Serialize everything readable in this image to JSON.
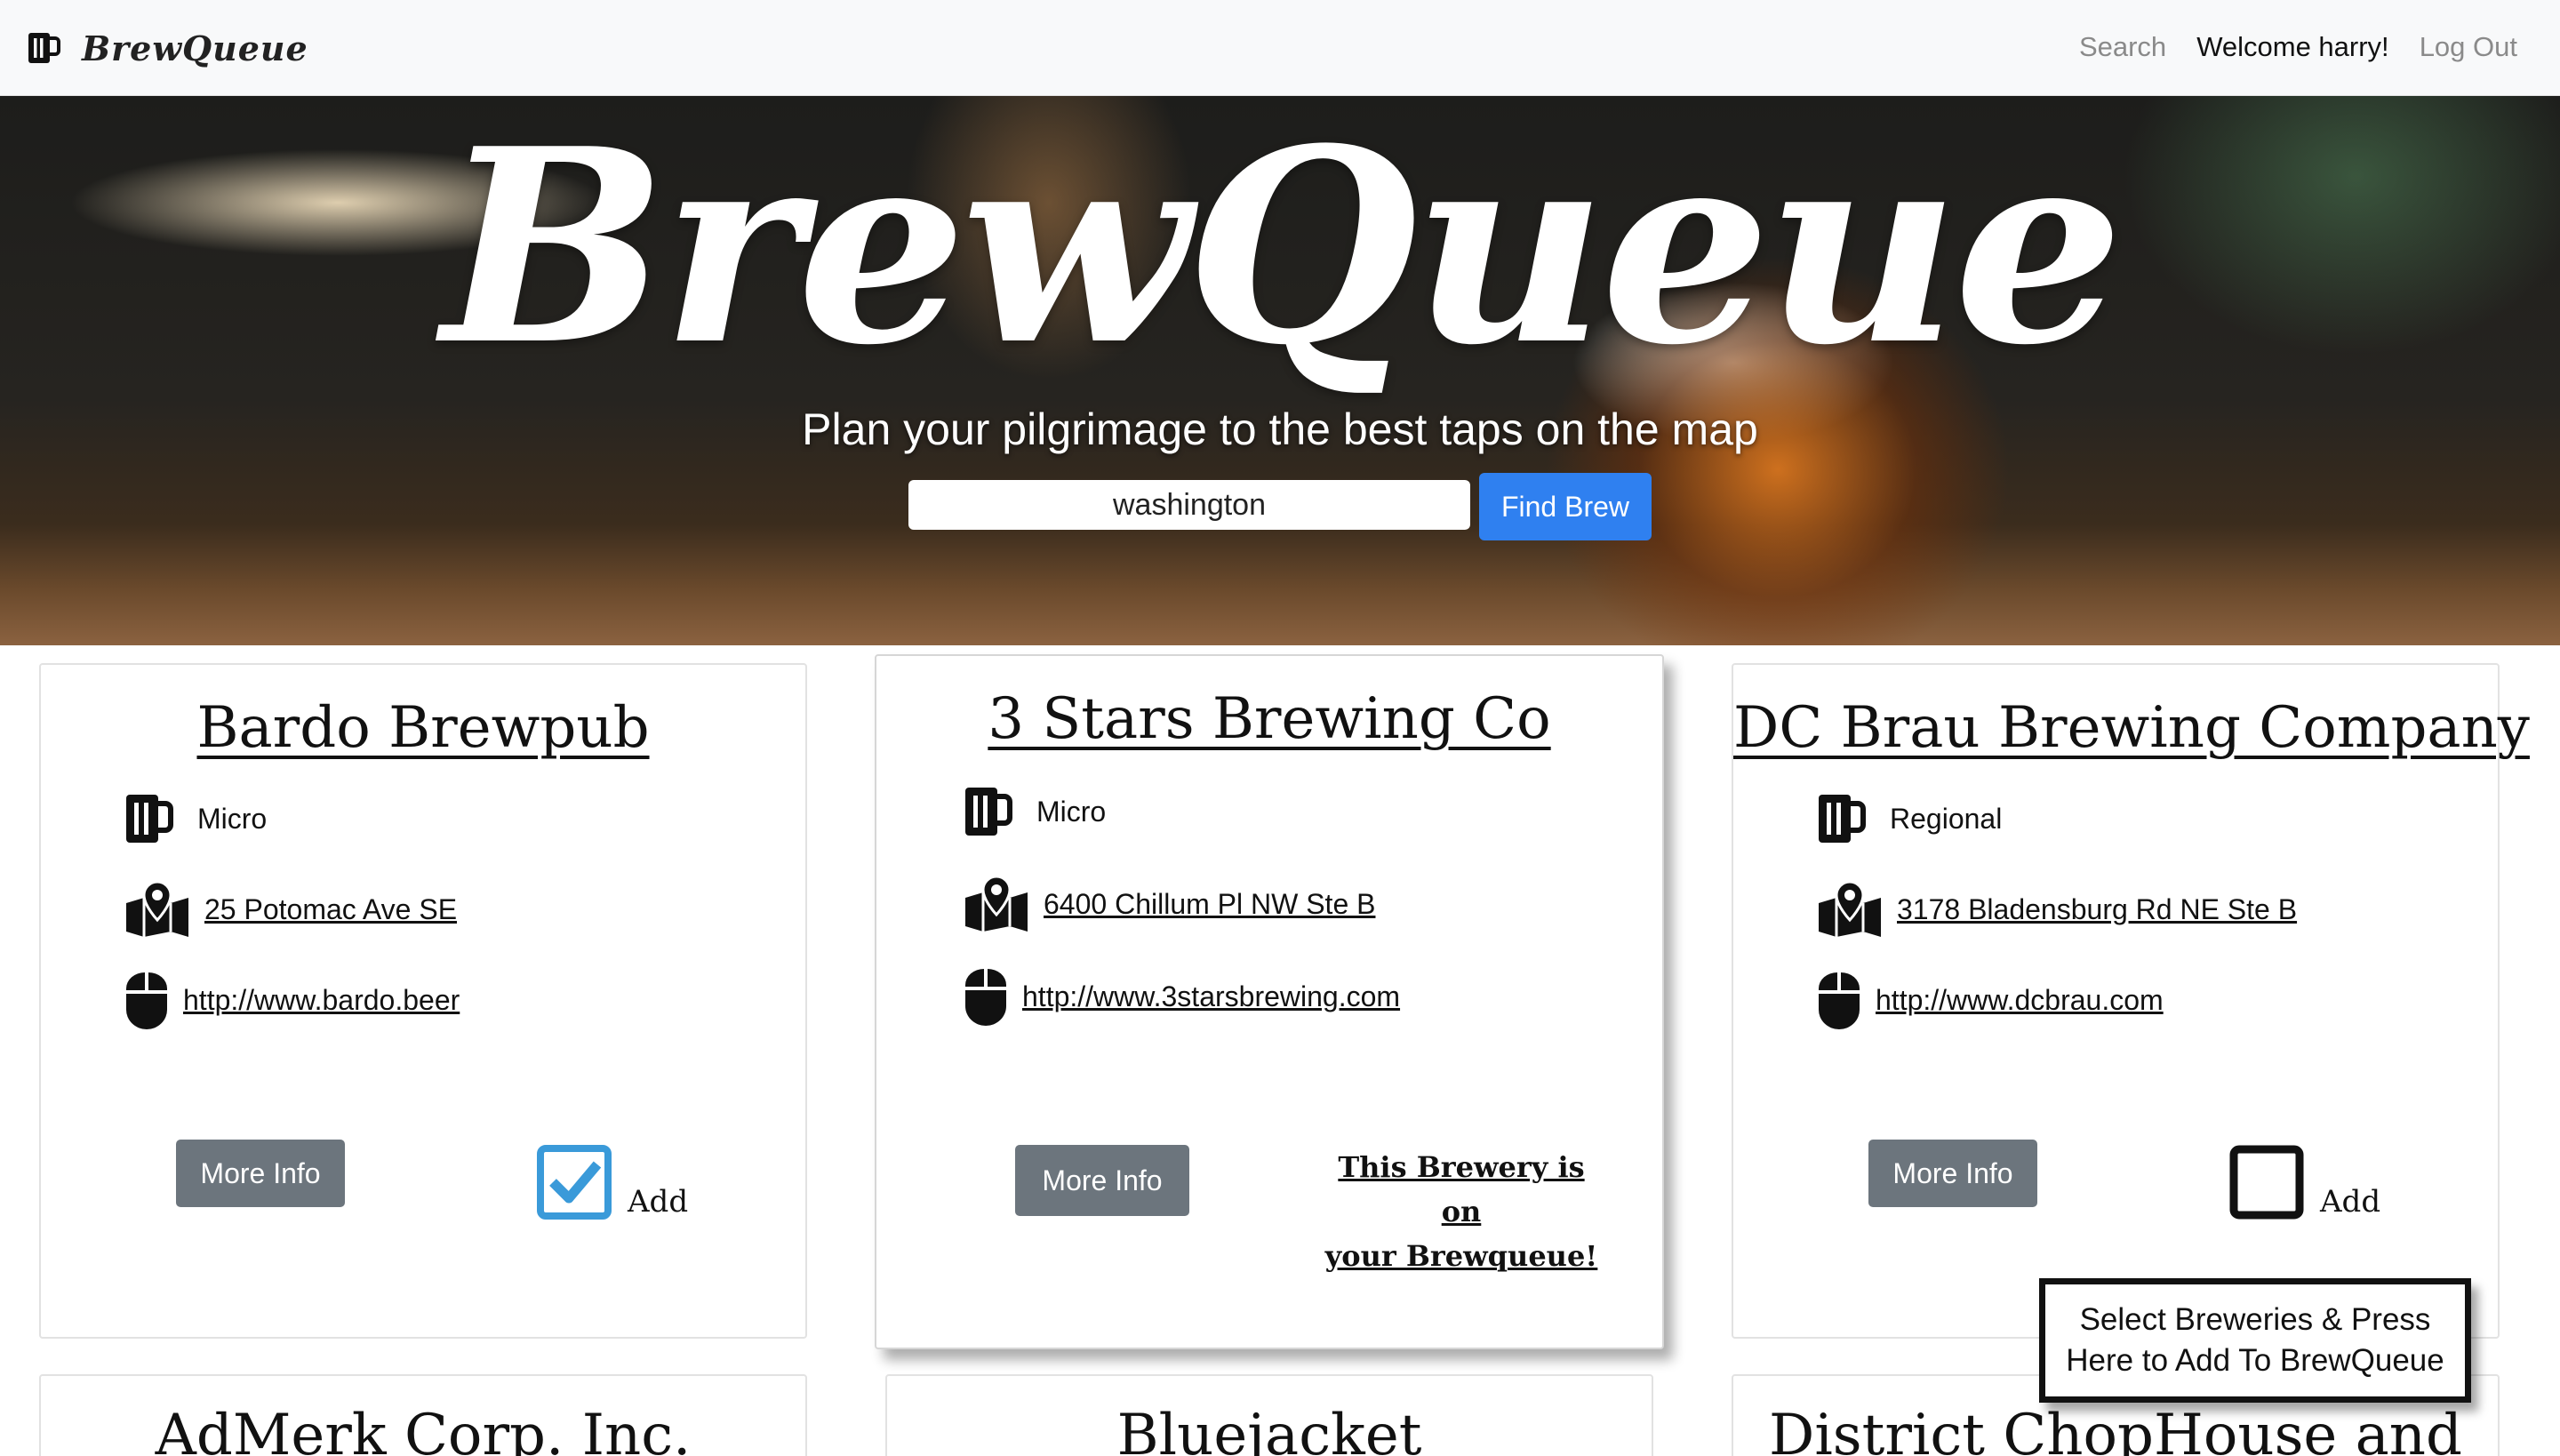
{
  "nav": {
    "brand": "BrewQueue",
    "search": "Search",
    "welcome": "Welcome harry!",
    "logout": "Log Out"
  },
  "hero": {
    "wordmark": "BrewQueue",
    "tagline": "Plan your pilgrimage to the best taps on the map",
    "search_value": "washington",
    "find_button": "Find Brew"
  },
  "cards": [
    {
      "name": "Bardo Brewpub",
      "type": "Micro",
      "address": "25 Potomac Ave SE",
      "website": "http://www.bardo.beer",
      "more_info": "More Info",
      "add_label": "Add",
      "checked": true
    },
    {
      "name": "3 Stars Brewing Co",
      "type": "Micro",
      "address": "6400 Chillum Pl NW Ste B",
      "website": "http://www.3starsbrewing.com",
      "more_info": "More Info",
      "on_queue_line1": "This Brewery is on",
      "on_queue_line2": "your Brewqueue!"
    },
    {
      "name": "DC Brau Brewing Company",
      "type": "Regional",
      "address": "3178 Bladensburg Rd NE Ste B",
      "website": "http://www.dcbrau.com",
      "more_info": "More Info",
      "add_label": "Add",
      "checked": false
    },
    {
      "name": "AdMerk Corp. Inc."
    },
    {
      "name": "Bluejacket"
    },
    {
      "name": "District ChopHouse and"
    }
  ],
  "tooltip": {
    "line1": "Select Breweries & Press",
    "line2": "Here to Add To BrewQueue"
  },
  "colors": {
    "primary_button": "#2f80f0",
    "secondary_button": "#6c757d",
    "checkbox_checked": "#3a9ad9",
    "navbar_bg": "#f8f9fa"
  },
  "icons": {
    "type": "beer-mug-icon",
    "address": "map-marker-icon",
    "website": "mouse-icon"
  }
}
